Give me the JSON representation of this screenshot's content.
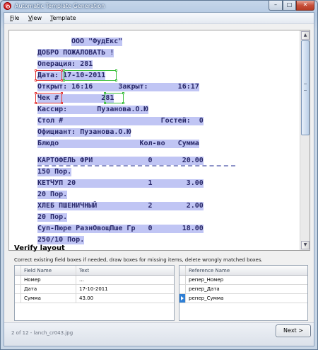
{
  "window": {
    "title": "Automatic Template Generation",
    "buttons": {
      "minimize": "–",
      "maximize": "□",
      "close": "✕"
    }
  },
  "menu": {
    "file": {
      "accel": "F",
      "rest": "ile"
    },
    "view": {
      "accel": "V",
      "rest": "iew"
    },
    "template": {
      "accel": "T",
      "rest": "emplate"
    }
  },
  "receipt": {
    "lines": [
      {
        "text": "ООО \"ФудЕкс\""
      },
      {
        "text": "ДОБРО ПОЖАЛОВАТЬ !"
      },
      {
        "text": "Операция: 281"
      },
      {
        "text": "Дата: 17-10-2011"
      },
      {
        "text": "Открыт: 16:16      Закрыт:       16:17"
      },
      {
        "text": "Чек #          281"
      },
      {
        "text": "Кассир:       Пузанова.О.Ю"
      },
      {
        "text": "Стол #                       Гостей:  0"
      },
      {
        "text": "Официант: Пузанова.О.Ю"
      },
      {
        "text": "Блюдо                   Кол-во   Сумма"
      },
      {
        "text": "КАРТОФЕЛЬ ФРИ             0       20.00"
      },
      {
        "text": "150 Пор."
      },
      {
        "text": "КЕТЧУП 20                 1        3.00"
      },
      {
        "text": "20 Пор."
      },
      {
        "text": "ХЛЕБ ПШЕНИЧНЫЙ            2        2.00"
      },
      {
        "text": "20 Пор."
      },
      {
        "text": "Суп-Пюре РазнОвощПше Гр   0       18.00"
      },
      {
        "text": "250/10 Пор."
      }
    ],
    "marker_colors": {
      "reference": "#e23a3a",
      "value": "#3cbf3c"
    }
  },
  "verify": {
    "title": "Verify layout",
    "instructions": "Correct existing field boxes if needed, draw boxes for missing items, delete wrongly matched boxes."
  },
  "fields_table": {
    "headers": [
      "Field Name",
      "Text"
    ],
    "rows": [
      {
        "name": "Номер",
        "text": "..."
      },
      {
        "name": "Дата",
        "text": "17-10-2011"
      },
      {
        "name": "Сумма",
        "text": "43.00"
      }
    ]
  },
  "reference_table": {
    "headers": [
      "Reference Name"
    ],
    "rows": [
      {
        "name": "репер_Номер"
      },
      {
        "name": "репер_Дата"
      },
      {
        "name": "репер_Сумма",
        "selected": true
      }
    ]
  },
  "status": {
    "text": "2 of 12 - lanch_cr043.jpg",
    "next_label": "Next >"
  }
}
